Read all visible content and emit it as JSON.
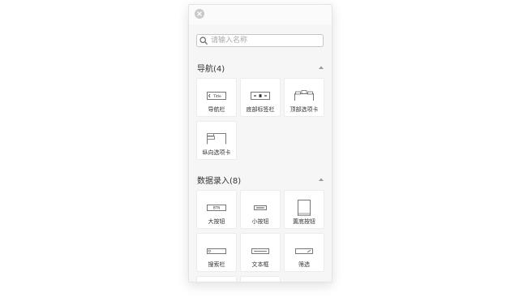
{
  "panel": {
    "search": {
      "placeholder": "请输入名称"
    },
    "groups": [
      {
        "title": "导航(4)",
        "items": [
          {
            "label": "导航栏",
            "icon": "navbar-icon",
            "icon_text": "Title"
          },
          {
            "label": "底部标签栏",
            "icon": "bottom-tabbar-icon"
          },
          {
            "label": "顶部选项卡",
            "icon": "top-tabs-icon"
          },
          {
            "label": "纵向选项卡",
            "icon": "vertical-tabs-icon"
          }
        ]
      },
      {
        "title": "数据录入(8)",
        "items": [
          {
            "label": "大按钮",
            "icon": "large-button-icon",
            "icon_text": "BTN"
          },
          {
            "label": "小按钮",
            "icon": "small-button-icon"
          },
          {
            "label": "置底按钮",
            "icon": "bottom-button-icon"
          },
          {
            "label": "搜索栏",
            "icon": "searchbar-icon"
          },
          {
            "label": "文本框",
            "icon": "textbox-icon"
          },
          {
            "label": "筛选",
            "icon": "filter-icon"
          }
        ]
      }
    ]
  },
  "colors": {
    "panel_bg": "#f6f6f6",
    "tile_bg": "#ffffff",
    "close": "#c9c9c9",
    "glyph_stroke": "#555555"
  }
}
